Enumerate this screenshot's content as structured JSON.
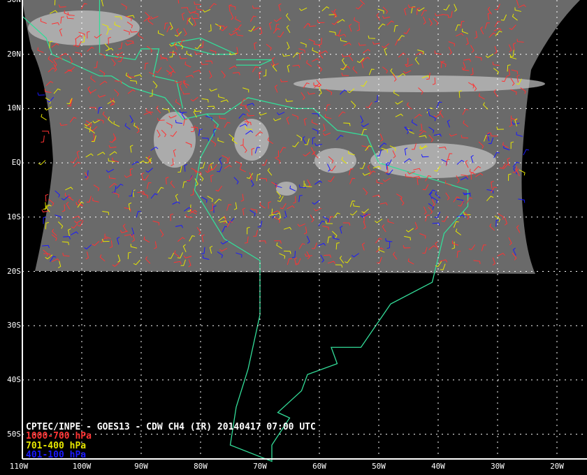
{
  "title": "CPTEC/INPE - GOES13 - CDW CH4 (IR) 20140417 07:00 UTC",
  "legend": [
    {
      "label": "1000-700 hPa",
      "color": "#ff3333"
    },
    {
      "label": "701-400 hPa",
      "color": "#e6e600"
    },
    {
      "label": "401-100 hPa",
      "color": "#1a1aff"
    }
  ],
  "lat_labels": [
    "30N",
    "20N",
    "10N",
    "EQ",
    "10S",
    "20S",
    "30S",
    "40S",
    "50S"
  ],
  "lon_labels": [
    "110W",
    "100W",
    "90W",
    "80W",
    "70W",
    "60W",
    "50W",
    "40W",
    "30W",
    "20W"
  ],
  "colors": {
    "coast": "#33dd99",
    "grid": "#ffffff",
    "satellite": "#6a6a6a"
  }
}
